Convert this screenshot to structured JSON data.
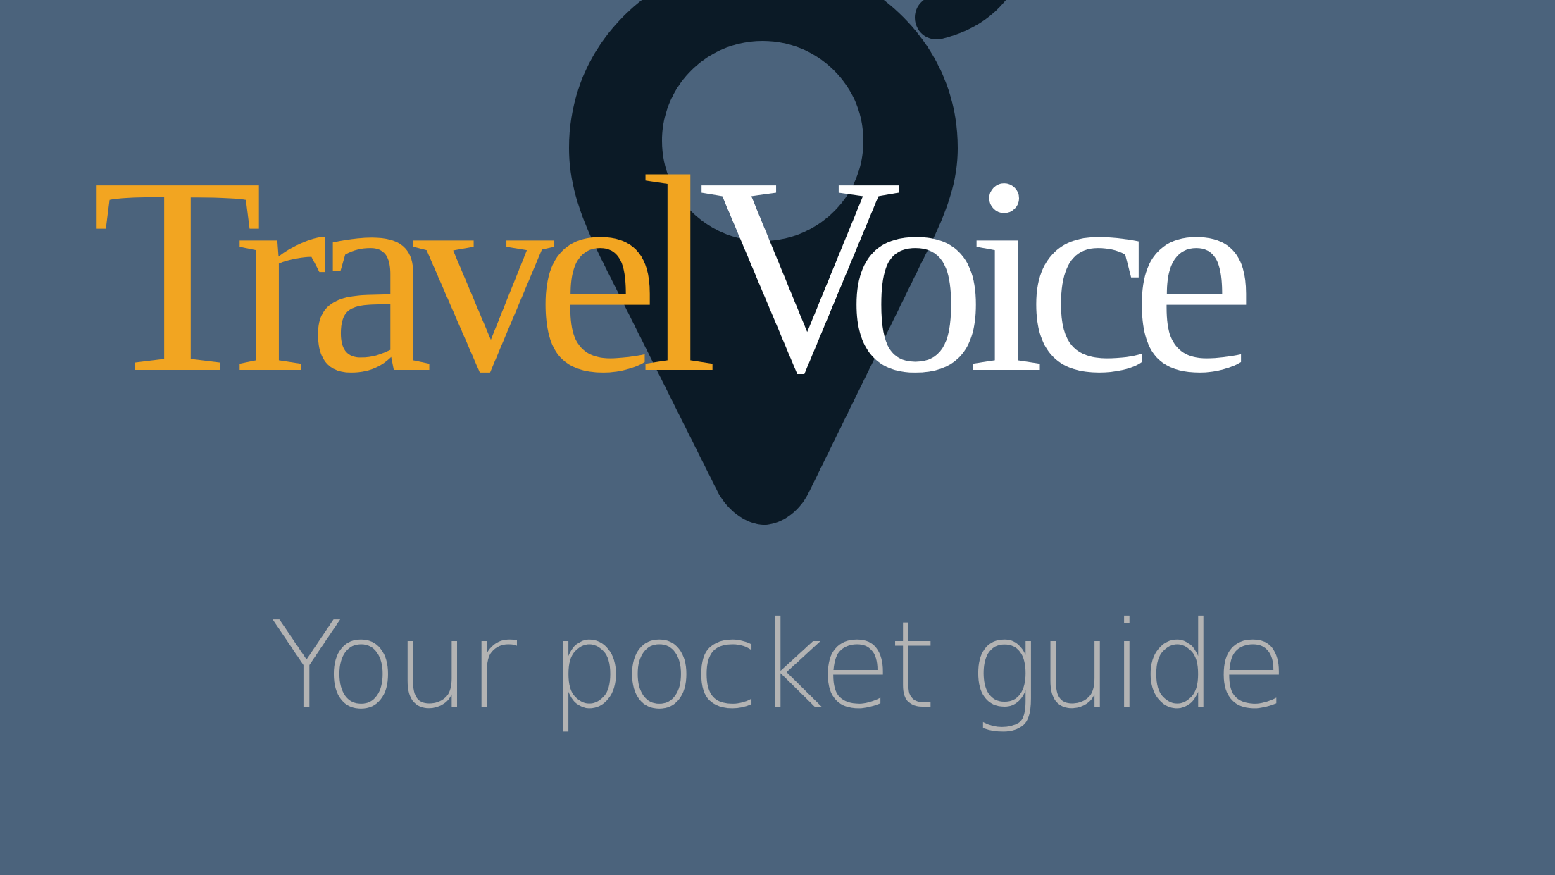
{
  "splash": {
    "logo": {
      "word1": "Travel",
      "word2": "Voice",
      "word1_color": "#f2a521",
      "word2_color": "#ffffff"
    },
    "tagline": "Your pocket guide",
    "icon": "map-pin-icon",
    "background_color": "#4b637c",
    "pin_color": "#0b1a26",
    "tagline_color": "#b3b3b3"
  }
}
